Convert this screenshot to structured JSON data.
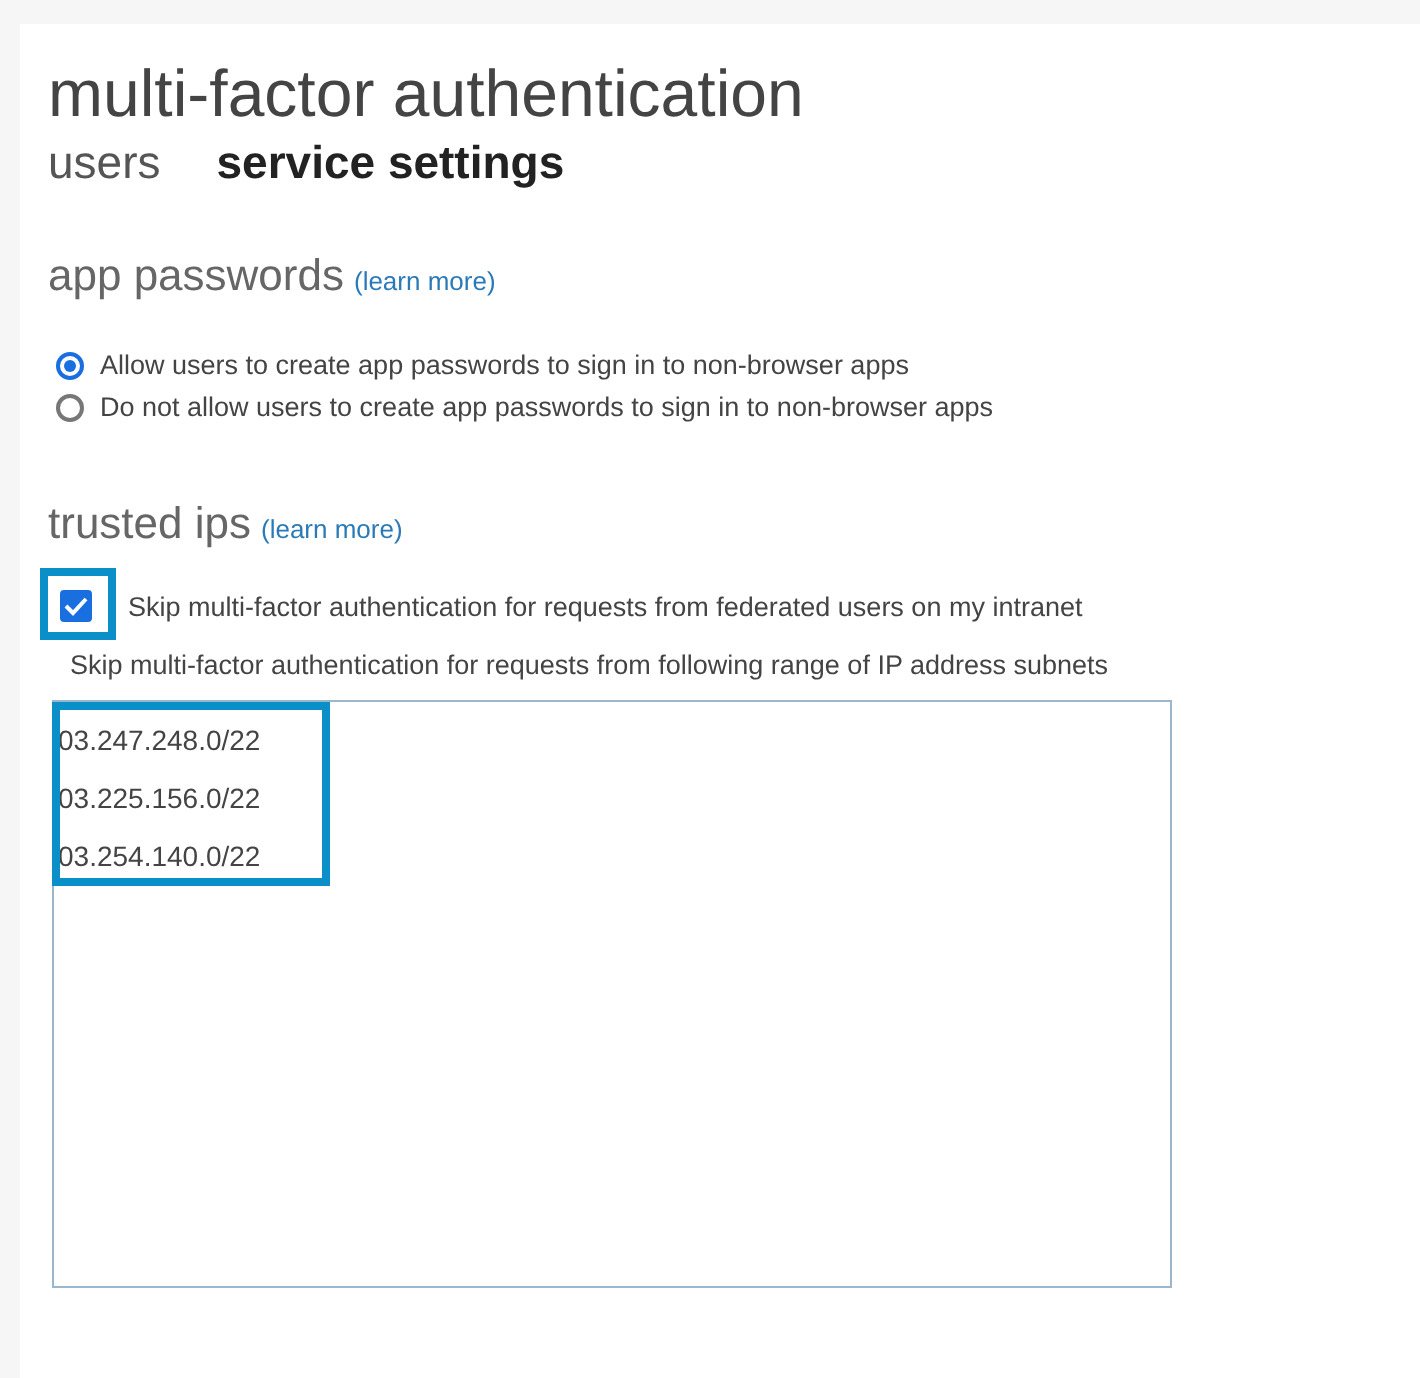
{
  "title": "multi-factor authentication",
  "tabs": [
    {
      "label": "users",
      "selected": false
    },
    {
      "label": "service settings",
      "selected": true
    }
  ],
  "app_passwords": {
    "heading": "app passwords",
    "link": "(learn more)",
    "options": [
      {
        "label": "Allow users to create app passwords to sign in to non-browser apps",
        "selected": true
      },
      {
        "label": "Do not allow users to create app passwords to sign in to non-browser apps",
        "selected": false
      }
    ]
  },
  "trusted_ips": {
    "heading": "trusted ips",
    "link": "(learn more)",
    "federated": {
      "label": "Skip multi-factor authentication for requests from federated users on my intranet",
      "checked": true,
      "highlighted": true
    },
    "subnets_label": "Skip multi-factor authentication for requests from following range of IP address subnets",
    "subnets": {
      "highlighted": true,
      "lines": [
        "03.247.248.0/22",
        "03.225.156.0/22",
        "03.254.140.0/22"
      ]
    }
  }
}
